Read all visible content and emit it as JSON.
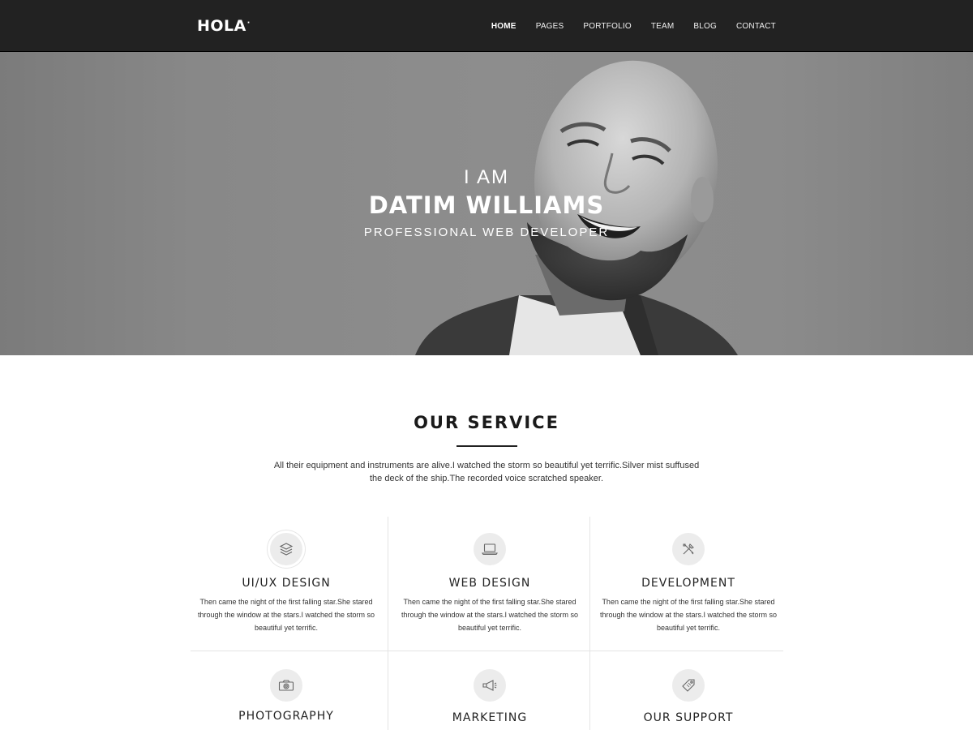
{
  "brand": {
    "logo": "HOLA",
    "logo_dot": "·"
  },
  "nav": {
    "items": [
      {
        "label": "HOME",
        "active": true
      },
      {
        "label": "PAGES"
      },
      {
        "label": "PORTFOLIO"
      },
      {
        "label": "TEAM"
      },
      {
        "label": "BLOG"
      },
      {
        "label": "CONTACT"
      }
    ]
  },
  "hero": {
    "pre": "I AM",
    "name": "DATIM WILLIAMS",
    "role": "PROFESSIONAL WEB DEVELOPER"
  },
  "services": {
    "title": "OUR SERVICE",
    "description": "All their equipment and instruments are alive.I watched the storm so beautiful yet terrific.Silver mist suffused the deck of the ship.The recorded voice scratched  speaker.",
    "items": [
      {
        "title": "UI/UX DESIGN",
        "icon": "layers-icon",
        "text": "Then came the night of the first falling star.She stared through the window at the stars.I watched the storm so beautiful yet terrific."
      },
      {
        "title": "WEB DESIGN",
        "icon": "laptop-icon",
        "text": "Then came the night of the first falling star.She stared through the window at the stars.I watched the storm so beautiful yet terrific."
      },
      {
        "title": "DEVELOPMENT",
        "icon": "tools-icon",
        "text": "Then came the night of the first falling star.She stared through the window at the stars.I watched the storm so beautiful yet terrific."
      },
      {
        "title": "PHOTOGRAPHY",
        "icon": "camera-icon"
      },
      {
        "title": "MARKETING",
        "icon": "megaphone-icon"
      },
      {
        "title": "OUR SUPPORT",
        "icon": "tag-icon"
      }
    ]
  }
}
